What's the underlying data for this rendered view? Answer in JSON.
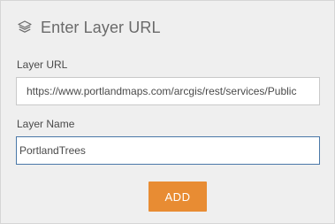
{
  "dialog": {
    "title": "Enter Layer URL",
    "title_icon": "layers-icon"
  },
  "fields": {
    "url": {
      "label": "Layer URL",
      "value": "https://www.portlandmaps.com/arcgis/rest/services/Public"
    },
    "name": {
      "label": "Layer Name",
      "value": "PortlandTrees"
    }
  },
  "actions": {
    "add_label": "ADD"
  },
  "colors": {
    "panel_background": "#efefef",
    "button_accent": "#e88c33",
    "focused_border": "#4a78a8"
  }
}
